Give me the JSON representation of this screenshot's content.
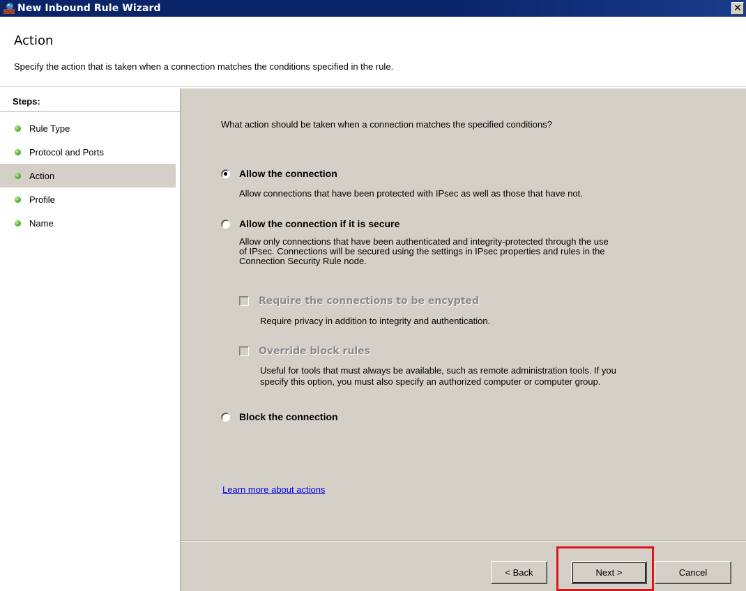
{
  "window": {
    "title": "New Inbound Rule Wizard",
    "close_glyph": "✕"
  },
  "header": {
    "title": "Action",
    "description": "Specify the action that is taken when a connection matches the conditions specified in the rule."
  },
  "steps": {
    "title": "Steps:",
    "items": [
      {
        "label": "Rule Type",
        "active": false
      },
      {
        "label": "Protocol and Ports",
        "active": false
      },
      {
        "label": "Action",
        "active": true
      },
      {
        "label": "Profile",
        "active": false
      },
      {
        "label": "Name",
        "active": false
      }
    ]
  },
  "main": {
    "question": "What action should be taken when a connection matches the specified conditions?",
    "options": [
      {
        "label": "Allow the connection",
        "checked": true,
        "description": "Allow connections that have been protected with IPsec as well as those that have not."
      },
      {
        "label": "Allow the connection if it is secure",
        "checked": false,
        "description_lines": [
          "Allow only connections that have been authenticated and integrity-protected through the use",
          "of IPsec.  Connections will be secured using the settings in IPsec properties and rules in the",
          "Connection Security Rule node."
        ]
      },
      {
        "label": "Block the connection",
        "checked": false
      }
    ],
    "sub_options": [
      {
        "label": "Require the connections to be encypted",
        "checked": false,
        "enabled": false,
        "description": "Require privacy in addition to integrity and authentication."
      },
      {
        "label": "Override block rules",
        "checked": false,
        "enabled": false,
        "description_lines": [
          "Useful for tools that must always be available, such as remote administration tools.  If you",
          "specify this option, you must also specify an authorized computer or computer group."
        ]
      }
    ],
    "learn_more": "Learn more about actions"
  },
  "buttons": {
    "back": "< Back",
    "next": "Next >",
    "cancel": "Cancel"
  },
  "colors": {
    "title_bar": "#0a246a",
    "dialog_face": "#d4d0c8",
    "link": "#0000ee",
    "highlight_box": "#e0141c",
    "step_dot": "#5fbf3a"
  }
}
